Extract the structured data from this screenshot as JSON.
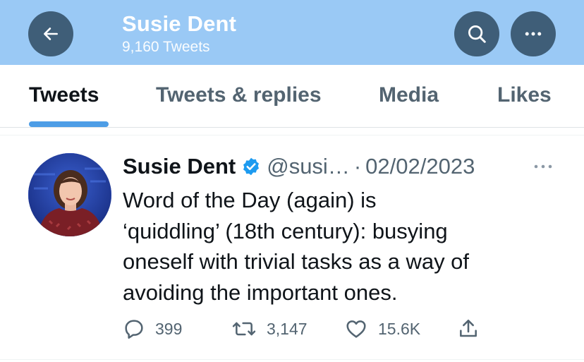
{
  "header": {
    "title": "Susie Dent",
    "subtitle": "9,160 Tweets",
    "bg_color": "#9ac9f5",
    "button_color": "#3f5e78",
    "back_icon": "arrow-left-icon",
    "search_icon": "search-icon",
    "more_icon": "more-horizontal-icon"
  },
  "tabs": [
    {
      "label": "Tweets",
      "active": true
    },
    {
      "label": "Tweets & replies",
      "active": false
    },
    {
      "label": "Media",
      "active": false
    },
    {
      "label": "Likes",
      "active": false
    }
  ],
  "accent_color": "#4d9de6",
  "tweet": {
    "author_name": "Susie Dent",
    "verified": true,
    "handle": "@susi…",
    "separator": "·",
    "date": "02/02/2023",
    "text_lines": [
      "Word of the Day (again) is",
      "‘quiddling’ (18th century): busying",
      "oneself with trivial tasks as a way of",
      "avoiding the important ones."
    ],
    "stats": {
      "replies": "399",
      "retweets": "3,147",
      "likes": "15.6K"
    },
    "icons": {
      "reply": "reply-bubble-icon",
      "retweet": "retweet-icon",
      "like": "heart-icon",
      "share": "share-icon",
      "more": "more-horizontal-icon"
    }
  }
}
